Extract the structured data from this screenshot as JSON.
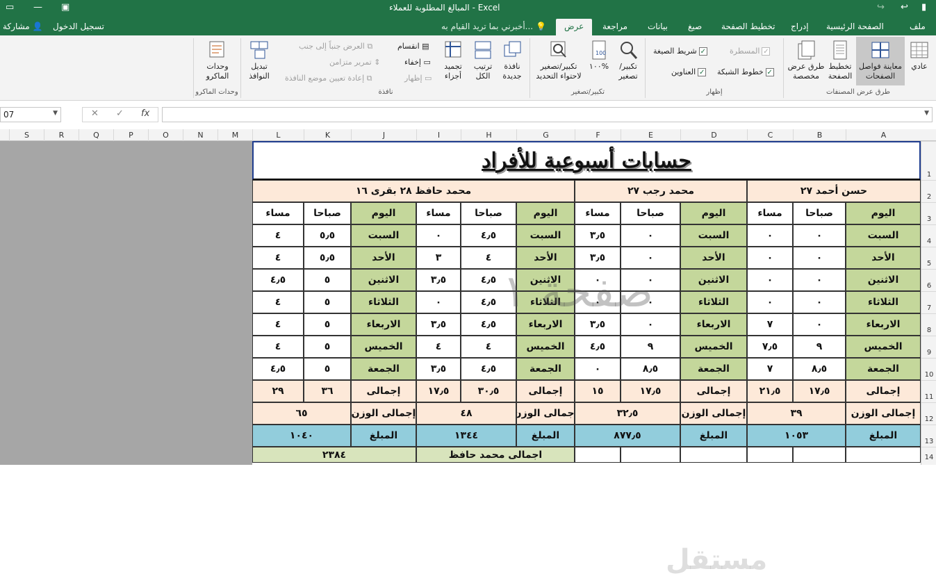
{
  "window": {
    "title": "المبالغ المطلوبة للعملاء  -  Excel"
  },
  "tabs": {
    "file": "ملف",
    "home": "الصفحة الرئيسية",
    "insert": "إدراج",
    "layout": "تخطيط الصفحة",
    "formulas": "صيغ",
    "data": "بيانات",
    "review": "مراجعة",
    "view": "عرض",
    "tellme": "أخبرني بما تريد القيام به...",
    "signin": "تسجيل الدخول",
    "share": "مشاركة"
  },
  "ribbon": {
    "normal": "عادي",
    "page_break": "معاينة فواصل الصفحات",
    "page_layout": "تخطيط الصفحة",
    "custom_views": "طرق عرض مخصصة",
    "grp_views": "طرق عرض المصنفات",
    "ruler": "المسطرة",
    "gridlines": "خطوط الشبكة",
    "formula_bar": "شريط الصيغة",
    "headings": "العناوين",
    "grp_show": "إظهار",
    "zoom": "تكبير/ تصغير",
    "zoom100": "١٠٠%",
    "zoom_sel": "تكبير/تصغير لاحتواء التحديد",
    "grp_zoom": "تكبير/تصغير",
    "new_window": "نافذة جديدة",
    "arrange_all": "ترتيب الكل",
    "freeze": "تجميد أجزاء",
    "split": "انقسام",
    "hide": "إخفاء",
    "unhide": "إظهار",
    "side_by_side": "العرض جنباً إلى جنب",
    "sync_scroll": "تمرير متزامن",
    "reset_pos": "إعادة تعيين موضع النافذة",
    "switch": "تبديل النوافذ",
    "grp_window": "نافذة",
    "macros": "وحدات الماكرو",
    "grp_macros": "وحدات الماكرو"
  },
  "formula": {
    "namebox": "07",
    "fx": "fx"
  },
  "columns": [
    "A",
    "B",
    "C",
    "D",
    "E",
    "F",
    "G",
    "H",
    "I",
    "J",
    "K",
    "L",
    "M",
    "N",
    "O",
    "P",
    "Q",
    "R",
    "S"
  ],
  "rows": [
    "1",
    "2",
    "3",
    "4",
    "5",
    "6",
    "7",
    "8",
    "9",
    "10",
    "11",
    "12",
    "13",
    "14"
  ],
  "sheet": {
    "title": "حسابات أسبوعية للأفراد",
    "watermark": "صفحة ١",
    "logo": "مستقل",
    "persons": [
      "حسن أحمد   ٢٧",
      "محمد رجب  ٢٧",
      "محمد حافظ  ٢٨ بقرى ١٦"
    ],
    "hdr_day": "اليوم",
    "hdr_morning": "صباحا",
    "hdr_evening": "مساء",
    "days": [
      "السبت",
      "الأحد",
      "الاثنين",
      "الثلاثاء",
      "الاربعاء",
      "الخميس",
      "الجمعة"
    ],
    "total_label": "إجمالى",
    "weight_label": "إجمالى الوزن",
    "amount_label": "المبلغ",
    "grand_label": "اجمالى محمد حافظ",
    "grand_value": "٢٣٨٤",
    "p1": {
      "morning": [
        "٠",
        "٠",
        "٠",
        "٠",
        "٠",
        "٩",
        "٨٫٥"
      ],
      "evening": [
        "٠",
        "٠",
        "٠",
        "٠",
        "٧",
        "٧٫٥",
        "٧"
      ],
      "total_m": "١٧٫٥",
      "total_e": "٢١٫٥",
      "weight": "٣٩",
      "amount": "١٠٥٣"
    },
    "p2": {
      "morning": [
        "٠",
        "٠",
        "٠",
        "٠",
        "٠",
        "٩",
        "٨٫٥"
      ],
      "evening": [
        "٣٫٥",
        "٣٫٥",
        "٠",
        "٠",
        "٣٫٥",
        "٤٫٥",
        "٠"
      ],
      "total_m": "١٧٫٥",
      "total_e": "١٥",
      "weight": "٣٢٫٥",
      "amount": "٨٧٧٫٥"
    },
    "p3": {
      "morning": [
        "٤٫٥",
        "٤",
        "٤٫٥",
        "٤٫٥",
        "٤٫٥",
        "٤",
        "٤٫٥"
      ],
      "evening": [
        "٠",
        "٣",
        "٣٫٥",
        "٠",
        "٣٫٥",
        "٤",
        "٣٫٥"
      ],
      "total_m": "٣٠٫٥",
      "total_e": "١٧٫٥",
      "weight": "٤٨",
      "amount": "١٣٤٤"
    },
    "p4": {
      "morning": [
        "٥٫٥",
        "٥٫٥",
        "٥",
        "٥",
        "٥",
        "٥",
        "٥"
      ],
      "evening": [
        "٤",
        "٤",
        "٤٫٥",
        "٤",
        "٤",
        "٤",
        "٤٫٥"
      ],
      "total_m": "٣٦",
      "total_e": "٢٩",
      "weight": "٦٥",
      "amount": "١٠٤٠"
    }
  }
}
